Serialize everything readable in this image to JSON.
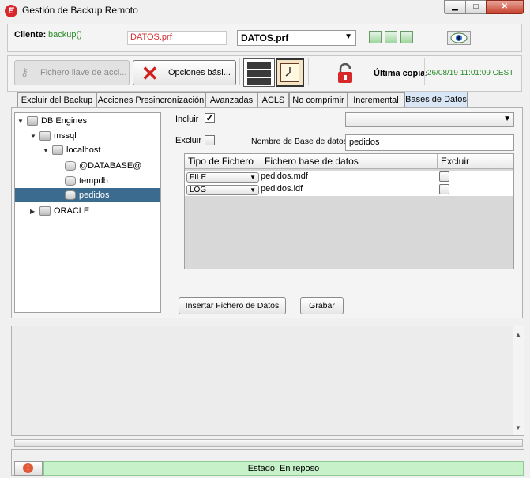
{
  "window": {
    "title": "Gestión de Backup Remoto",
    "app_icon_letter": "E"
  },
  "client": {
    "label": "Cliente:",
    "value": "backup()",
    "profile_field": "DATOS.prf",
    "profile_select": "DATOS.prf"
  },
  "toolbar": {
    "keyfile_label": "Fichero llave de acci...",
    "options_label": "Opciones bási...",
    "last_copy_label": "Última copia:",
    "last_copy_value": "26/08/19 11:01:09 CEST"
  },
  "tabs": [
    {
      "label": "Excluir del Backup"
    },
    {
      "label": "Acciones Presincronización"
    },
    {
      "label": "Avanzadas"
    },
    {
      "label": "ACLS"
    },
    {
      "label": "No comprimir"
    },
    {
      "label": "Incremental"
    },
    {
      "label": "Bases de Datos",
      "active": true
    }
  ],
  "tree": [
    {
      "label": "DB Engines",
      "expanded": true,
      "icon": "folder-icon"
    },
    {
      "label": "mssql",
      "expanded": true,
      "icon": "engine-icon"
    },
    {
      "label": "localhost",
      "expanded": true,
      "icon": "server-icon"
    },
    {
      "label": "@DATABASE@",
      "icon": "database-icon"
    },
    {
      "label": "tempdb",
      "icon": "database-icon"
    },
    {
      "label": "pedidos",
      "icon": "database-icon",
      "selected": true
    },
    {
      "label": "ORACLE",
      "expanded": false,
      "icon": "engine-icon"
    }
  ],
  "form": {
    "incluir_label": "Incluir",
    "incluir_checked": true,
    "excluir_label": "Excluir",
    "excluir_checked": false,
    "dbname_label": "Nombre de Base de datos",
    "dbname_value": "pedidos"
  },
  "table": {
    "headers": [
      "Tipo de Fichero",
      "Fichero base de datos",
      "Excluir"
    ],
    "rows": [
      {
        "type": "FILE",
        "file": "pedidos.mdf",
        "excluded": false
      },
      {
        "type": "LOG",
        "file": "pedidos.ldf",
        "excluded": false
      }
    ]
  },
  "buttons": {
    "insert": "Insertar Fichero de Datos",
    "save": "Grabar"
  },
  "status": {
    "text": "Estado: En reposo"
  }
}
